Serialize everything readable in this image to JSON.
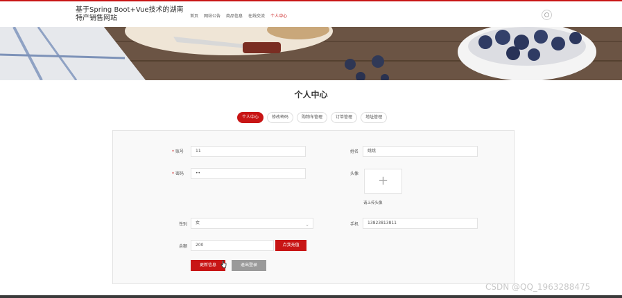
{
  "header": {
    "site_title": "基于Spring Boot+Vue技术的湖南特产销售网站",
    "nav": [
      {
        "label": "首页",
        "active": false
      },
      {
        "label": "网站公告",
        "active": false
      },
      {
        "label": "商品信息",
        "active": false
      },
      {
        "label": "在线交流",
        "active": false
      },
      {
        "label": "个人中心",
        "active": true
      }
    ]
  },
  "page": {
    "title": "个人中心"
  },
  "tabs": [
    {
      "label": "个人中心",
      "active": true
    },
    {
      "label": "修改密码",
      "active": false
    },
    {
      "label": "购物车管理",
      "active": false
    },
    {
      "label": "订单管理",
      "active": false
    },
    {
      "label": "地址管理",
      "active": false
    }
  ],
  "form": {
    "account": {
      "label": "账号",
      "value": "11",
      "required": true
    },
    "name": {
      "label": "姓名",
      "value": "姚姚"
    },
    "password": {
      "label": "密码",
      "value": "••",
      "required": true
    },
    "avatar": {
      "label": "头像",
      "upload_hint": "请上传头像",
      "icon": "plus-icon"
    },
    "gender": {
      "label": "性别",
      "value": "女"
    },
    "phone": {
      "label": "手机",
      "value": "13823813811"
    },
    "balance": {
      "label": "余额",
      "value": "200",
      "recharge_label": "点我充值"
    },
    "update_label": "更新信息",
    "logout_label": "退出登录"
  },
  "colors": {
    "accent": "#c81515"
  },
  "watermark": "CSDN @QQ_1963288475"
}
